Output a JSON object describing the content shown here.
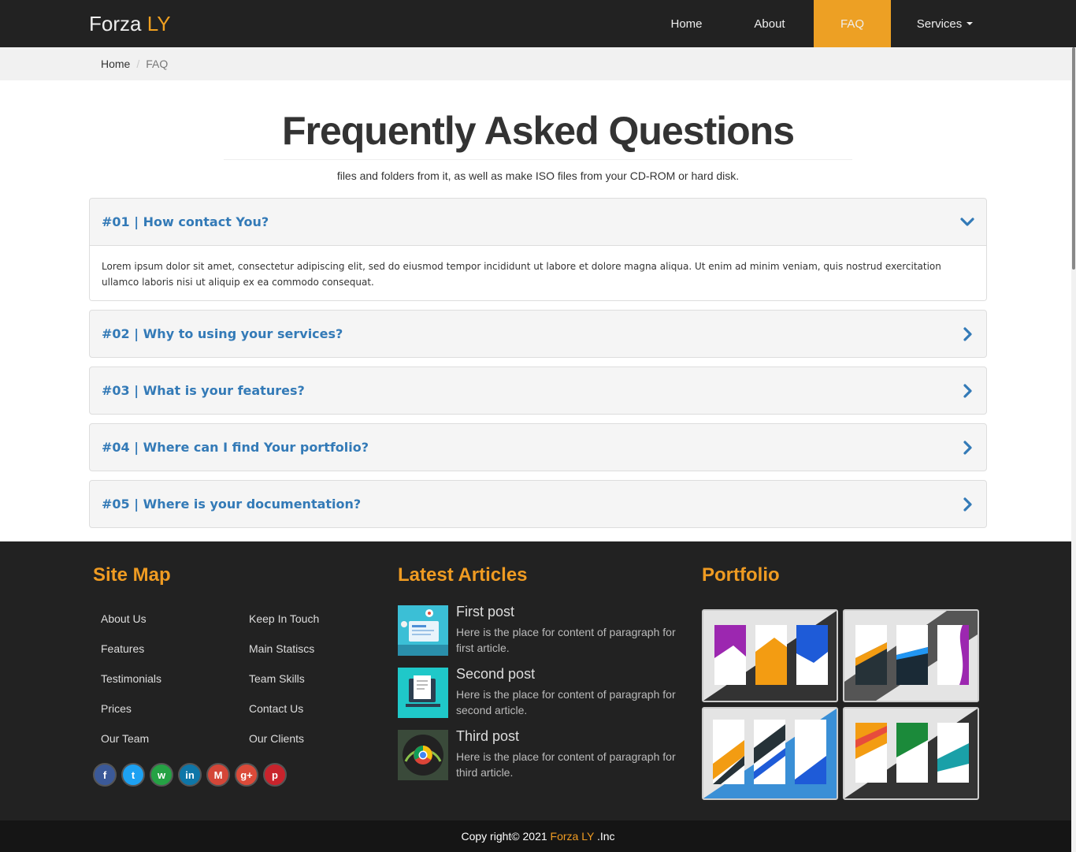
{
  "brand": {
    "name": "Forza",
    "accent": "LY"
  },
  "nav": {
    "items": [
      {
        "label": "Home"
      },
      {
        "label": "About"
      },
      {
        "label": "FAQ",
        "active": true
      },
      {
        "label": "Services"
      }
    ]
  },
  "breadcrumb": {
    "home": "Home",
    "separator": "/",
    "current": "FAQ"
  },
  "header": {
    "title": "Frequently Asked Questions",
    "subtitle": "files and folders from it, as well as make ISO files from your CD-ROM or hard disk."
  },
  "faq": [
    {
      "question": "#01 | How contact You?",
      "expanded": true,
      "answer": "Lorem ipsum dolor sit amet, consectetur adipiscing elit, sed do eiusmod tempor incididunt ut labore et dolore magna aliqua. Ut enim ad minim veniam, quis nostrud exercitation ullamco laboris nisi ut aliquip ex ea commodo consequat.",
      "icon": "chevron-down-icon"
    },
    {
      "question": "#02 | Why to using your services?",
      "expanded": false,
      "icon": "chevron-right-icon"
    },
    {
      "question": "#03 | What is your features?",
      "expanded": false,
      "icon": "chevron-right-icon"
    },
    {
      "question": "#04 | Where can I find Your portfolio?",
      "expanded": false,
      "icon": "chevron-right-icon"
    },
    {
      "question": "#05 | Where is your documentation?",
      "expanded": false,
      "icon": "chevron-right-icon"
    }
  ],
  "footer": {
    "sitemap": {
      "heading": "Site Map",
      "col1": [
        "About Us",
        "Features",
        "Testimonials",
        "Prices",
        "Our Team"
      ],
      "col2": [
        "Keep In Touch",
        "Main Statiscs",
        "Team Skills",
        "Contact Us",
        "Our Clients"
      ]
    },
    "social": [
      {
        "icon": "facebook-icon",
        "glyph": "f",
        "color": "#3b5998"
      },
      {
        "icon": "twitter-icon",
        "glyph": "t",
        "color": "#1da1f2"
      },
      {
        "icon": "whatsapp-icon",
        "glyph": "w",
        "color": "#25a244"
      },
      {
        "icon": "linkedin-icon",
        "glyph": "in",
        "color": "#0e76a8"
      },
      {
        "icon": "gmail-icon",
        "glyph": "M",
        "color": "#d44638"
      },
      {
        "icon": "google-plus-icon",
        "glyph": "g+",
        "color": "#db4a39"
      },
      {
        "icon": "pinterest-icon",
        "glyph": "p",
        "color": "#c8232c"
      }
    ],
    "articles": {
      "heading": "Latest Articles",
      "items": [
        {
          "title": "First post",
          "text": "Here is the place for content of paragraph for first article."
        },
        {
          "title": "Second post",
          "text": "Here is the place for content of paragraph for second article."
        },
        {
          "title": "Third post",
          "text": "Here is the place for content of paragraph for third article."
        }
      ]
    },
    "portfolio": {
      "heading": "Portfolio"
    },
    "copyright": {
      "prefix": "Copy right© 2021",
      "brand": "Forza LY",
      "suffix": ".Inc"
    }
  },
  "colors": {
    "accent": "#eda024",
    "link": "#337ab7",
    "dark": "#222222"
  }
}
